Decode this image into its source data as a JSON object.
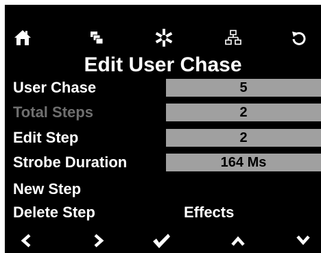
{
  "icons": {
    "top": [
      "home-icon",
      "layers-icon",
      "asterisk-icon",
      "network-icon",
      "undo-icon"
    ],
    "bottom": [
      "chevron-left-icon",
      "chevron-right-icon",
      "checkmark-icon",
      "chevron-up-icon",
      "chevron-down-icon"
    ]
  },
  "colors": {
    "background": "#000000",
    "text": "#ffffff",
    "value_box": "#a0a0a0",
    "disabled_text": "#6f6f6f"
  },
  "title": "Edit User Chase",
  "fields": [
    {
      "label": "User Chase",
      "value": "5",
      "enabled": true
    },
    {
      "label": "Total Steps",
      "value": "2",
      "enabled": false
    },
    {
      "label": "Edit Step",
      "value": "2",
      "enabled": true
    },
    {
      "label": "Strobe Duration",
      "value": "164 Ms",
      "enabled": true
    }
  ],
  "menu": {
    "new_step": "New Step",
    "delete_step": "Delete Step",
    "effects": "Effects"
  }
}
